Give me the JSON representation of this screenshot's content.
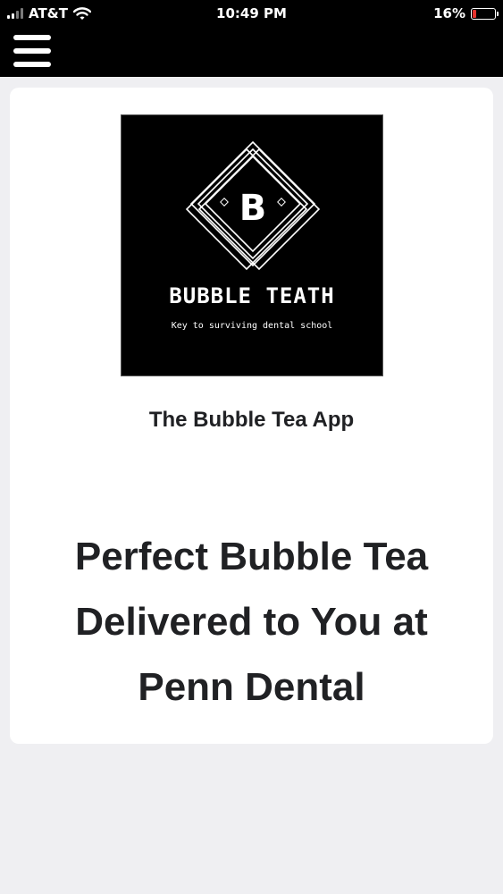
{
  "status_bar": {
    "carrier": "AT&T",
    "time": "10:49 PM",
    "battery_percent": "16%",
    "battery_level": 0.16,
    "battery_color": "#e5322d",
    "signal_bars": 2,
    "icons": [
      "signal-icon",
      "wifi-icon",
      "battery-icon"
    ]
  },
  "nav": {
    "menu_icon": "hamburger-menu-icon"
  },
  "logo": {
    "emblem_letter": "B",
    "title": "BUBBLE TEATH",
    "tagline": "Key to surviving dental school"
  },
  "app_name": "The Bubble Tea App",
  "headline": "Perfect Bubble Tea Delivered to You at Penn Dental",
  "colors": {
    "bars": "#000000",
    "page_background": "#efeff2",
    "card_background": "#ffffff",
    "text": "#202124"
  }
}
